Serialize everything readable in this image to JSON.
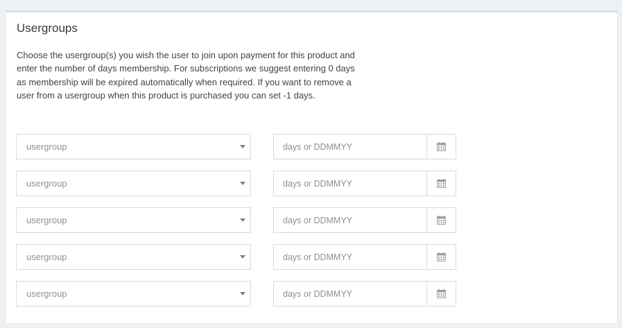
{
  "panel": {
    "title": "Usergroups",
    "description": "Choose the usergroup(s) you wish the user to join upon payment for this product and enter the number of days membership. For subscriptions we suggest entering 0 days as membership will be expired automatically when required. If you want to remove a user from a usergroup when this product is purchased you can set -1 days."
  },
  "rows": [
    {
      "select_value": "usergroup",
      "days_placeholder": "days or DDMMYY",
      "days_value": ""
    },
    {
      "select_value": "usergroup",
      "days_placeholder": "days or DDMMYY",
      "days_value": ""
    },
    {
      "select_value": "usergroup",
      "days_placeholder": "days or DDMMYY",
      "days_value": ""
    },
    {
      "select_value": "usergroup",
      "days_placeholder": "days or DDMMYY",
      "days_value": ""
    },
    {
      "select_value": "usergroup",
      "days_placeholder": "days or DDMMYY",
      "days_value": ""
    }
  ],
  "icons": {
    "dropdown": "chevron-down-icon",
    "calendar": "calendar-icon"
  },
  "colors": {
    "background": "#edf1f5",
    "panel": "#ffffff",
    "border": "#d5dbe1",
    "text": "#3d434a",
    "placeholder": "#8a9099"
  }
}
